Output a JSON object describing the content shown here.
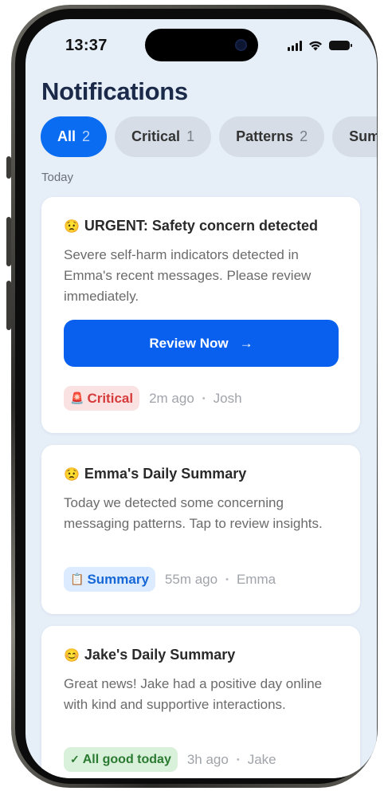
{
  "status_bar": {
    "time": "13:37"
  },
  "page": {
    "title": "Notifications",
    "section_today": "Today"
  },
  "filters": [
    {
      "label": "All",
      "count": "2",
      "active": true
    },
    {
      "label": "Critical",
      "count": "1",
      "active": false
    },
    {
      "label": "Patterns",
      "count": "2",
      "active": false
    },
    {
      "label": "Sum",
      "count": "",
      "active": false
    }
  ],
  "notifications": [
    {
      "emoji": "😟",
      "title": "URGENT: Safety concern detected",
      "body": "Severe self-harm indicators detected in Emma's recent messages. Please review immediately.",
      "cta_label": "Review Now",
      "cta_arrow": "→",
      "tag_icon": "🚨",
      "tag_label": "Critical",
      "time": "2m ago",
      "person": "Josh"
    },
    {
      "emoji": "😟",
      "title": "Emma's Daily Summary",
      "body": "Today we detected some concerning messaging patterns. Tap to review insights.",
      "tag_icon": "📋",
      "tag_label": "Summary",
      "time": "55m ago",
      "person": "Emma"
    },
    {
      "emoji": "😊",
      "title": "Jake's Daily Summary",
      "body": "Great news! Jake had a positive day online with kind and supportive interactions.",
      "tag_icon": "✓",
      "tag_label": "All good today",
      "time": "3h ago",
      "person": "Jake"
    }
  ],
  "meta_separator": "•",
  "colors": {
    "accent": "#0a60ee",
    "background": "#e6eef8",
    "critical": "#d63b3b",
    "summary": "#1767d6",
    "good": "#2b7a31"
  }
}
